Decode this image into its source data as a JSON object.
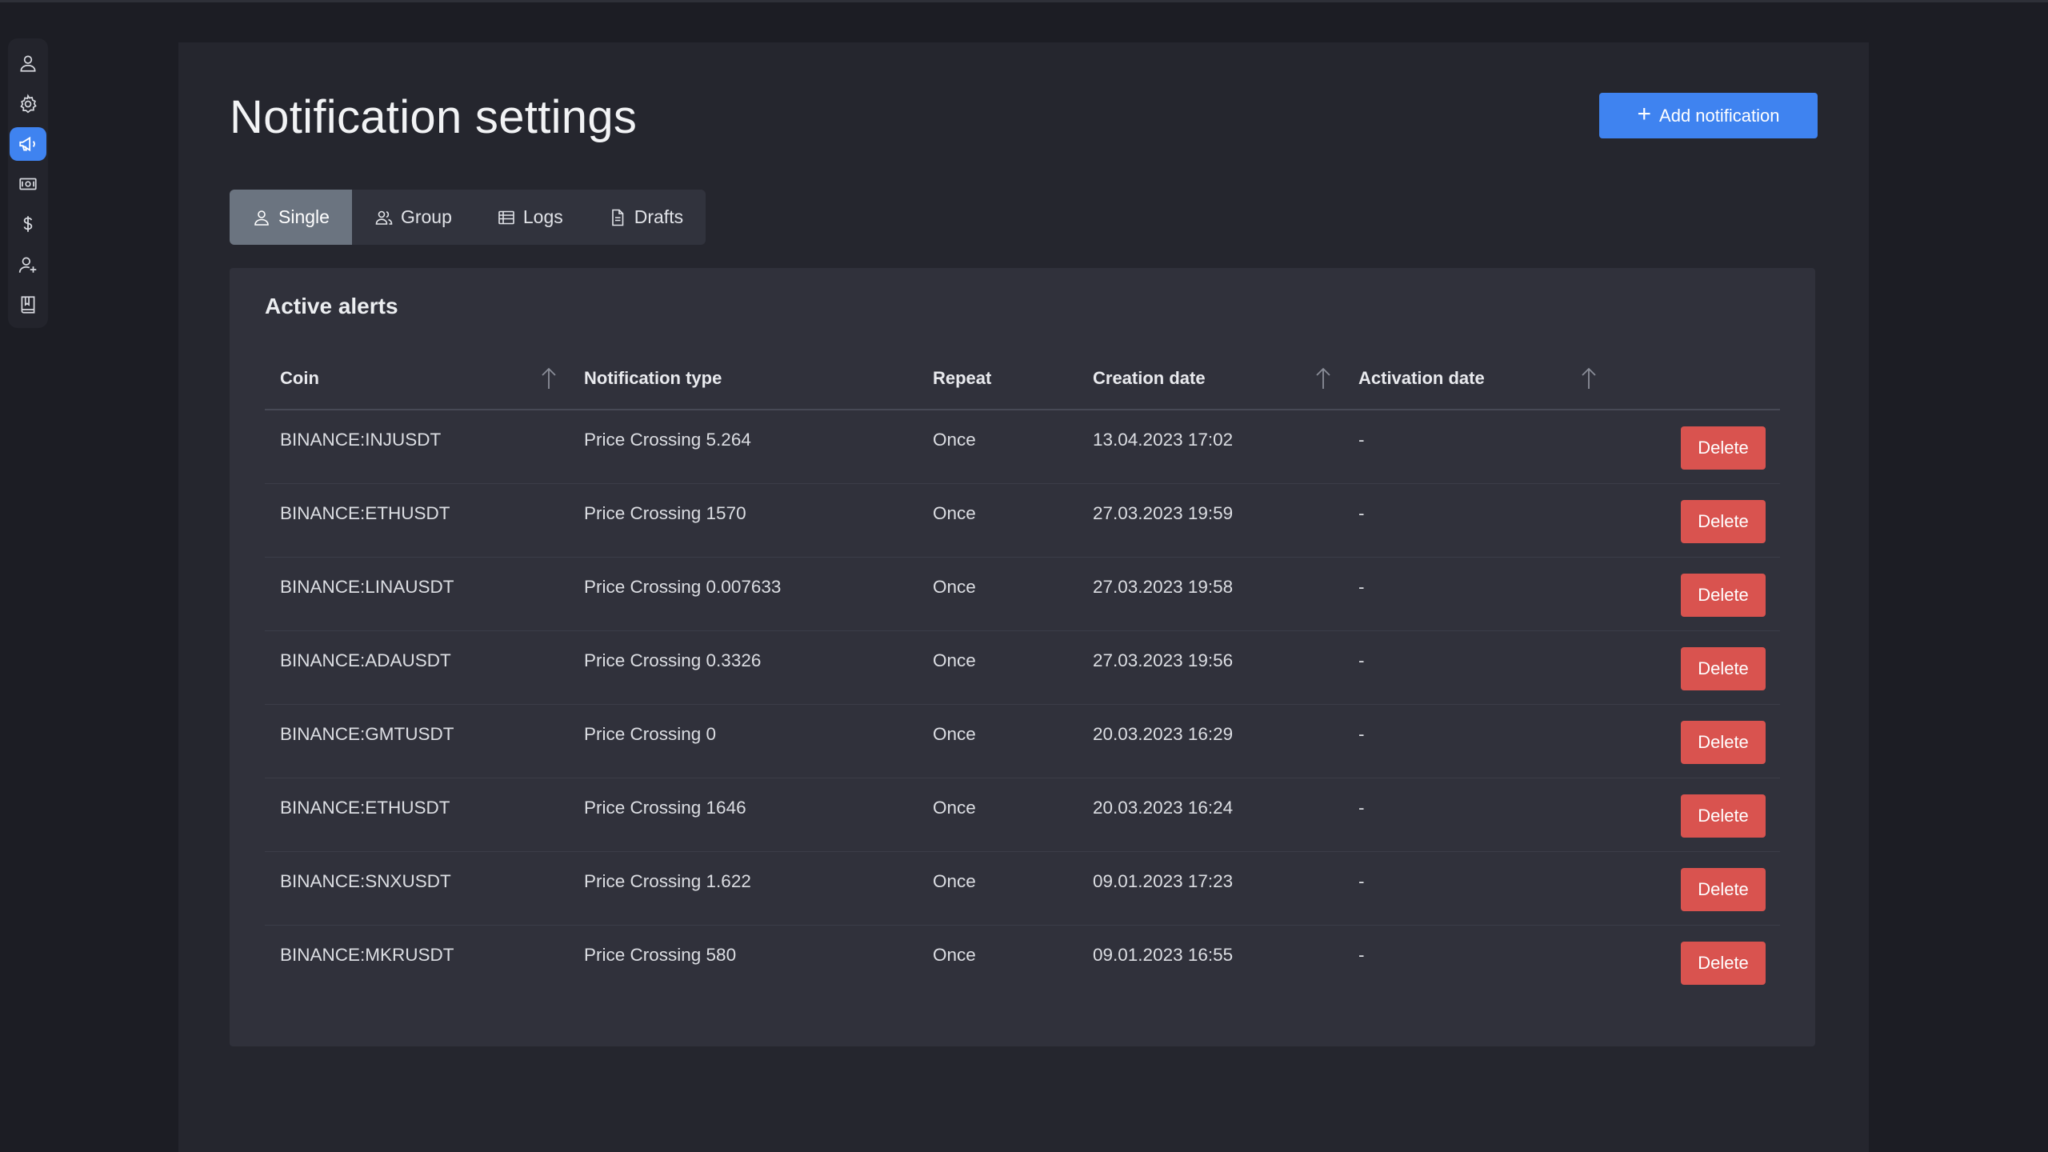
{
  "page": {
    "title": "Notification settings"
  },
  "actions": {
    "add_label": "Add notification"
  },
  "tabs": [
    {
      "label": "Single",
      "icon": "user-icon",
      "active": true
    },
    {
      "label": "Group",
      "icon": "group-icon",
      "active": false
    },
    {
      "label": "Logs",
      "icon": "list-icon",
      "active": false
    },
    {
      "label": "Drafts",
      "icon": "document-icon",
      "active": false
    }
  ],
  "sidebar": {
    "items": [
      {
        "icon": "user-icon"
      },
      {
        "icon": "gear-icon"
      },
      {
        "icon": "megaphone-icon",
        "active": true
      },
      {
        "icon": "banknote-icon"
      },
      {
        "icon": "dollar-icon"
      },
      {
        "icon": "user-plus-icon"
      },
      {
        "icon": "book-icon"
      }
    ]
  },
  "card": {
    "title": "Active alerts"
  },
  "table": {
    "headers": {
      "coin": "Coin",
      "type": "Notification type",
      "repeat": "Repeat",
      "created": "Creation date",
      "activation": "Activation date"
    },
    "delete_label": "Delete",
    "rows": [
      {
        "coin": "BINANCE:INJUSDT",
        "type": "Price Crossing 5.264",
        "repeat": "Once",
        "created": "13.04.2023 17:02",
        "activation": "-"
      },
      {
        "coin": "BINANCE:ETHUSDT",
        "type": "Price Crossing 1570",
        "repeat": "Once",
        "created": "27.03.2023 19:59",
        "activation": "-"
      },
      {
        "coin": "BINANCE:LINAUSDT",
        "type": "Price Crossing 0.007633",
        "repeat": "Once",
        "created": "27.03.2023 19:58",
        "activation": "-"
      },
      {
        "coin": "BINANCE:ADAUSDT",
        "type": "Price Crossing 0.3326",
        "repeat": "Once",
        "created": "27.03.2023 19:56",
        "activation": "-"
      },
      {
        "coin": "BINANCE:GMTUSDT",
        "type": "Price Crossing 0",
        "repeat": "Once",
        "created": "20.03.2023 16:29",
        "activation": "-"
      },
      {
        "coin": "BINANCE:ETHUSDT",
        "type": "Price Crossing 1646",
        "repeat": "Once",
        "created": "20.03.2023 16:24",
        "activation": "-"
      },
      {
        "coin": "BINANCE:SNXUSDT",
        "type": "Price Crossing 1.622",
        "repeat": "Once",
        "created": "09.01.2023 17:23",
        "activation": "-"
      },
      {
        "coin": "BINANCE:MKRUSDT",
        "type": "Price Crossing 580",
        "repeat": "Once",
        "created": "09.01.2023 16:55",
        "activation": "-"
      }
    ]
  },
  "colors": {
    "accent": "#3f83f0",
    "danger": "#d9534f",
    "panel": "#25262e",
    "card": "#30313b"
  }
}
